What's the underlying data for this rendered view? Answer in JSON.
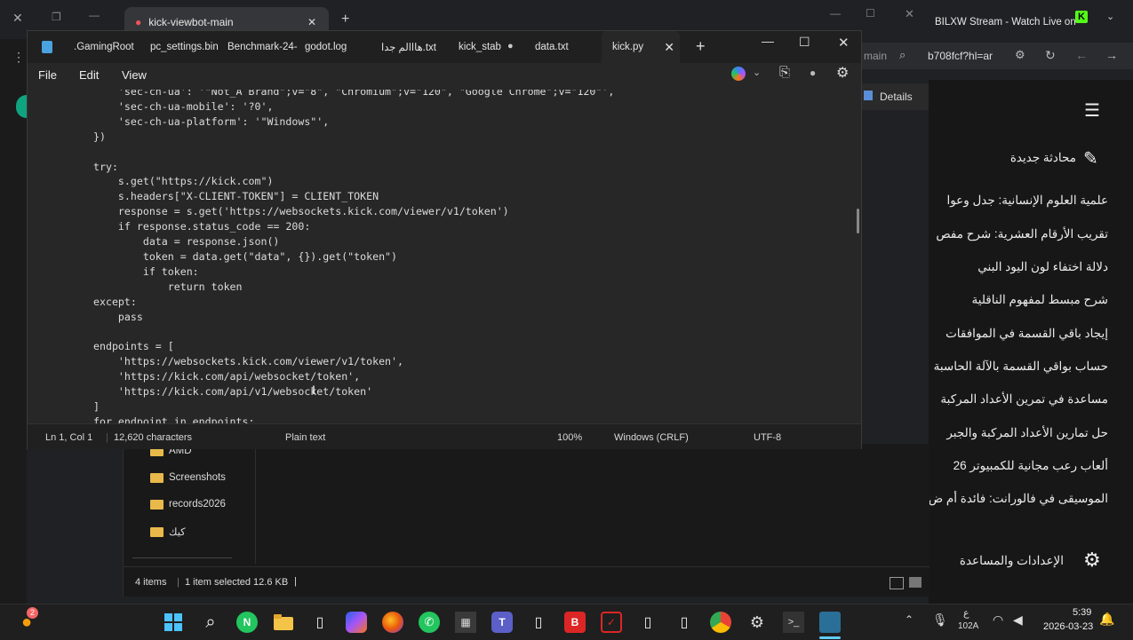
{
  "browser": {
    "tab_title": "kick-viewbot-main",
    "tab2_title": "BILXW Stream - Watch Live on",
    "address_partial_left": "main",
    "address_partial": "b708fcf?hl=ar",
    "details_label": "Details"
  },
  "chat_sidebar": {
    "new_chat": "محادثة جديدة",
    "history": [
      "علمية العلوم الإنسانية: جدل وعوا",
      "تقريب الأرقام العشرية: شرح مفص",
      "دلالة اختفاء لون اليود البني",
      "شرح مبسط لمفهوم الناقلية",
      "إيجاد باقي القسمة في الموافقات",
      "حساب بواقي القسمة بالآلة الحاسبة",
      "مساعدة في تمرين الأعداد المركبة",
      "حل تمارين الأعداد المركبة والجبر",
      "ألعاب رعب مجانية للكمبيوتر 26",
      "الموسيقى في فالورانت: فائدة أم ض"
    ],
    "settings": "الإعدادات والمساعدة"
  },
  "notepad": {
    "tabs": [
      ".GamingRoot",
      "pc_settings.bin",
      "Benchmark-24-",
      "godot.log",
      "هااالم جدا.txt",
      "kick_stab",
      "data.txt",
      "kick.py"
    ],
    "active_tab": "kick.py",
    "menu": {
      "file": "File",
      "edit": "Edit",
      "view": "View"
    },
    "code": "    'sec-ch-ua': '\"Not_A Brand\";v=\"8\", \"Chromium\";v=\"120\", \"Google Chrome\";v=\"120\"',\n    'sec-ch-ua-mobile': '?0',\n    'sec-ch-ua-platform': '\"Windows\"',\n})\n\ntry:\n    s.get(\"https://kick.com\")\n    s.headers[\"X-CLIENT-TOKEN\"] = CLIENT_TOKEN\n    response = s.get('https://websockets.kick.com/viewer/v1/token')\n    if response.status_code == 200:\n        data = response.json()\n        token = data.get(\"data\", {}).get(\"token\")\n        if token:\n            return token\nexcept:\n    pass\n\nendpoints = [\n    'https://websockets.kick.com/viewer/v1/token',\n    'https://kick.com/api/websocket/token',\n    'https://kick.com/api/v1/websocket/token'\n]\nfor endpoint in endpoints:",
    "status": {
      "position": "Ln 1, Col 1",
      "characters": "12,620 characters",
      "type": "Plain text",
      "zoom": "100%",
      "line_ending": "Windows (CRLF)",
      "encoding": "UTF-8"
    }
  },
  "explorer": {
    "folders": [
      "AMD",
      "Screenshots",
      "records2026",
      "كيك"
    ],
    "status": "4 items",
    "selected": "1 item selected  12.6 KB"
  },
  "taskbar": {
    "time": "5:39",
    "date": "2026-03-23",
    "lang": "ع",
    "lang2": "102A",
    "badge": "2"
  }
}
